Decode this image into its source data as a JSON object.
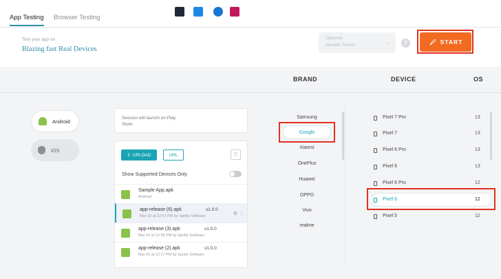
{
  "tabs": [
    {
      "label": "App Testing",
      "active": true
    },
    {
      "label": "Browser Testing",
      "active": false
    }
  ],
  "hero": {
    "subtitle": "Test your app on",
    "title": "Blazing fast Real Devices"
  },
  "tunnel": {
    "label": "Optional",
    "value": "Disable Tunnel"
  },
  "help_label": "?",
  "start_label": "START",
  "columns": {
    "brand": "BRAND",
    "device": "DEVICE",
    "os": "OS"
  },
  "os_options": [
    {
      "label": "Android",
      "selected": true
    },
    {
      "label": "iOS",
      "selected": false
    }
  ],
  "session": {
    "text": "Session will launch on Play Store"
  },
  "upload": {
    "upload_label": "UPLOAD",
    "url_label": "URL",
    "supported_label": "Show Supported Devices Only",
    "apps": [
      {
        "name": "Sample App.apk",
        "meta": "Android",
        "version": "",
        "selected": false
      },
      {
        "name": "app-release (6).apk",
        "meta": "Mar 03 at 12:57 PM by Spritle Software",
        "version": "v1.0.0",
        "selected": true
      },
      {
        "name": "app-release (3).apk",
        "meta": "Mar 03 at 12:38 PM by Spritle Software",
        "version": "v1.0.0",
        "selected": false
      },
      {
        "name": "app-release (2).apk",
        "meta": "Mar 01 at 12:17 PM by Spritle Software",
        "version": "v1.0.0",
        "selected": false
      }
    ]
  },
  "brands": [
    "Samsung",
    "Google",
    "Xiaomi",
    "OnePlus",
    "Huawei",
    "OPPO",
    "Vivo",
    "realme"
  ],
  "selected_brand": "Google",
  "devices": [
    {
      "name": "Pixel 7 Pro",
      "os": "13"
    },
    {
      "name": "Pixel 7",
      "os": "13"
    },
    {
      "name": "Pixel 6 Pro",
      "os": "13"
    },
    {
      "name": "Pixel 6",
      "os": "13"
    },
    {
      "name": "Pixel 6 Pro",
      "os": "12"
    },
    {
      "name": "Pixel 6",
      "os": "12"
    },
    {
      "name": "Pixel 5",
      "os": "12"
    }
  ],
  "selected_device_index": 5,
  "colors": {
    "accent": "#1ba4b5",
    "start": "#f36a21",
    "highlight": "#e0301e"
  }
}
